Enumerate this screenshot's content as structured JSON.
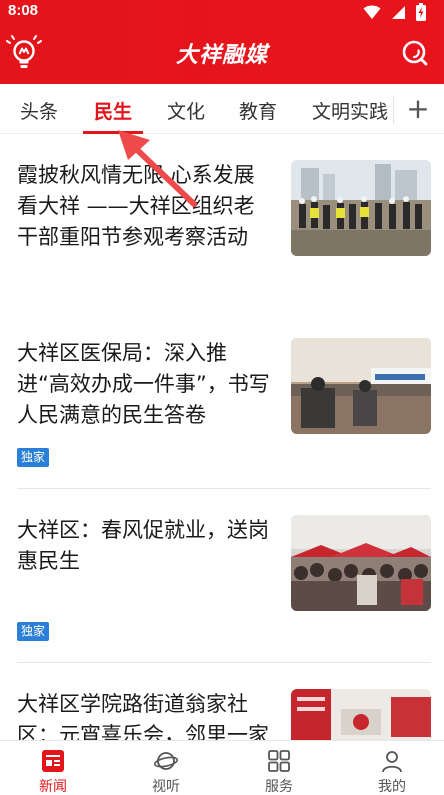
{
  "status_bar": {
    "time": "8:08",
    "icons": [
      "wifi-icon",
      "signal-icon",
      "battery-charging-icon"
    ]
  },
  "app_bar": {
    "title": "大祥融媒",
    "left_icon": "lightbulb-logo-icon",
    "right_icon": "search-icon"
  },
  "tabs": {
    "items": [
      {
        "label": "头条",
        "active": false
      },
      {
        "label": "民生",
        "active": true
      },
      {
        "label": "文化",
        "active": false
      },
      {
        "label": "教育",
        "active": false
      },
      {
        "label": "文明实践",
        "active": false
      }
    ],
    "add_symbol": "+"
  },
  "feed": {
    "articles": [
      {
        "title": "霞披秋风情无限 心系发展看大祥 ——大祥区组织老干部重阳节参观考察活动",
        "tag": ""
      },
      {
        "title": "大祥区医保局：深入推进“高效办成一件事”，书写人民满意的民生答卷",
        "tag": "独家"
      },
      {
        "title": "大祥区：春风促就业，送岗惠民生",
        "tag": "独家"
      },
      {
        "title": "大祥区学院路街道翁家社区：元宵喜乐会，邻里一家亲",
        "tag": ""
      }
    ]
  },
  "bottom_nav": {
    "items": [
      {
        "label": "新闻",
        "icon": "news-icon",
        "active": true
      },
      {
        "label": "视听",
        "icon": "planet-icon",
        "active": false
      },
      {
        "label": "服务",
        "icon": "grid-icon",
        "active": false
      },
      {
        "label": "我的",
        "icon": "person-icon",
        "active": false
      }
    ]
  },
  "colors": {
    "brand_red": "#e3151a",
    "tag_blue": "#2b7fd6",
    "annotation_red": "#ee4a4a"
  }
}
